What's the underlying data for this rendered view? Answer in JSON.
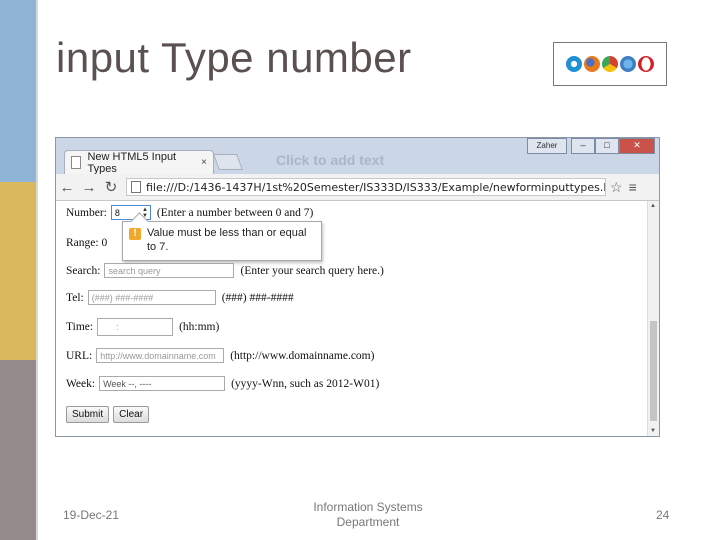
{
  "slide": {
    "title": "input Type number",
    "footer_date": "19-Dec-21",
    "footer_dept_line1": "Information Systems",
    "footer_dept_line2": "Department",
    "page_number": "24",
    "browser_logos": [
      "internet-explorer-icon",
      "firefox-icon",
      "chrome-icon",
      "safari-icon",
      "opera-icon"
    ]
  },
  "browser": {
    "tab_title": "New HTML5 Input Types",
    "tab_close": "×",
    "ghost_text": "Click to add text",
    "user_button": "Zaher",
    "minimize": "–",
    "maximize": "□",
    "close": "✕",
    "url": "file:///D:/1436-1437H/1st%20Semester/IS333D/IS333/Example/newforminputtypes.htm"
  },
  "form": {
    "number_label": "Number:",
    "number_value": "8",
    "number_hint": "(Enter a number between 0 and 7)",
    "range_label": "Range: 0",
    "tooltip_line1": "Value must be less than or equal",
    "tooltip_line2": "to 7.",
    "search_label": "Search:",
    "search_placeholder": "search query",
    "search_hint": "(Enter your search query here.)",
    "tel_label": "Tel:",
    "tel_placeholder": "(###) ###-####",
    "tel_hint": "(###) ###-####",
    "time_label": "Time:",
    "time_placeholder": ":",
    "time_hint": "(hh:mm)",
    "url_label": "URL:",
    "url_placeholder": "http://www.domainname.com",
    "url_hint": "(http://www.domainname.com)",
    "week_label": "Week:",
    "week_placeholder": "Week --, ----",
    "week_hint": "(yyyy-Wnn, such as 2012-W01)",
    "submit_label": "Submit",
    "clear_label": "Clear"
  }
}
